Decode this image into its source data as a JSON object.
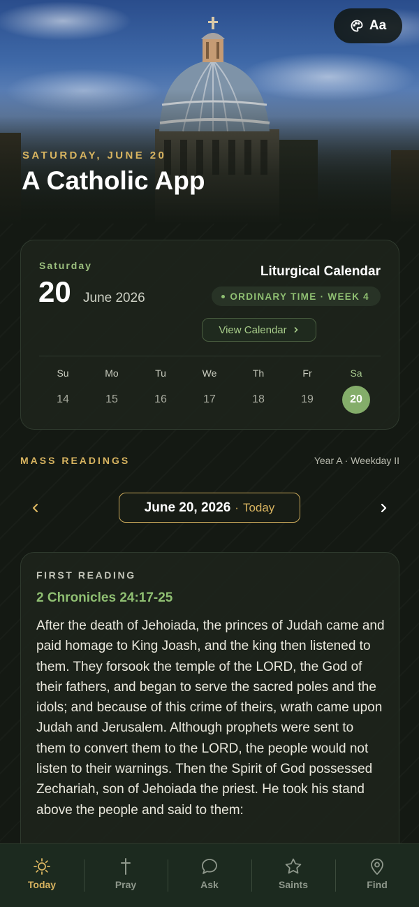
{
  "hero": {
    "date_label": "SATURDAY, JUNE 20",
    "title": "A Catholic App",
    "theme_button_label": "Aa",
    "theme_icon": "palette-icon"
  },
  "calendar": {
    "weekday": "Saturday",
    "day": "20",
    "month_year": "June 2026",
    "heading": "Liturgical Calendar",
    "season": "ORDINARY TIME · WEEK 4",
    "view_button": "View Calendar",
    "week": [
      {
        "label": "Su",
        "day": "14"
      },
      {
        "label": "Mo",
        "day": "15"
      },
      {
        "label": "Tu",
        "day": "16"
      },
      {
        "label": "We",
        "day": "17"
      },
      {
        "label": "Th",
        "day": "18"
      },
      {
        "label": "Fr",
        "day": "19"
      },
      {
        "label": "Sa",
        "day": "20",
        "selected": true
      }
    ]
  },
  "readings": {
    "section_label": "MASS READINGS",
    "cycle": "Year A · Weekday II",
    "date": "June 20, 2026",
    "date_separator": "·",
    "today": "Today",
    "first": {
      "label": "FIRST READING",
      "reference": "2 Chronicles 24:17-25",
      "text": "After the death of Jehoiada, the princes of Judah came and paid homage to King Joash, and the king then listened to them. They forsook the temple of the LORD, the God of their fathers, and began to serve the sacred poles and the idols; and because of this crime of theirs, wrath came upon Judah and Jerusalem. Although prophets were sent to them to convert them to the LORD, the people would not listen to their warnings. Then the Spirit of God possessed Zechariah, son of Jehoiada the priest. He took his stand above the people and said to them:"
    }
  },
  "nav": {
    "items": [
      {
        "label": "Today",
        "icon": "sun-icon",
        "active": true
      },
      {
        "label": "Pray",
        "icon": "cross-icon"
      },
      {
        "label": "Ask",
        "icon": "chat-bubble-icon"
      },
      {
        "label": "Saints",
        "icon": "star-icon"
      },
      {
        "label": "Find",
        "icon": "map-pin-icon"
      }
    ]
  },
  "colors": {
    "accent_gold": "#d8b460",
    "accent_green": "#8fbf72",
    "background": "#141913"
  }
}
